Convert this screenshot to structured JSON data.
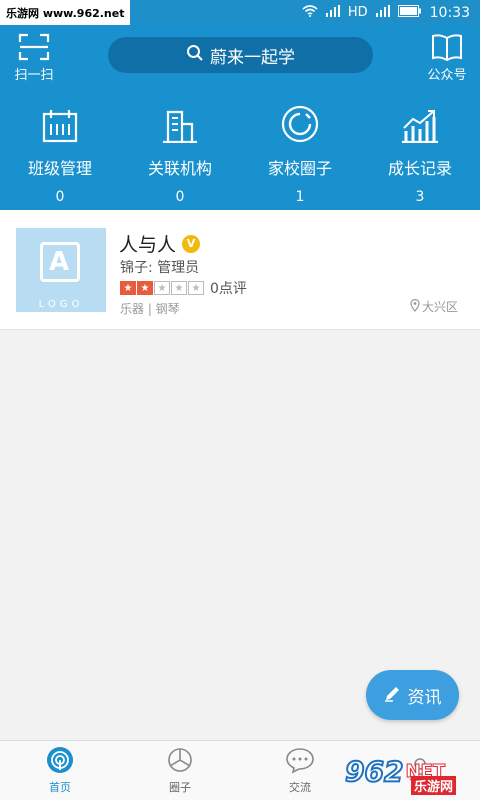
{
  "watermark_top": "乐游网 www.962.net",
  "status": {
    "network": "HD",
    "time": "10:33"
  },
  "header": {
    "scan_label": "扫一扫",
    "search_text": "蔚来一起学",
    "public_label": "公众号",
    "accent_color": "#1a91cf"
  },
  "features": [
    {
      "icon": "calendar-icon",
      "name": "班级管理",
      "count": "0"
    },
    {
      "icon": "building-icon",
      "name": "关联机构",
      "count": "0"
    },
    {
      "icon": "circle-icon",
      "name": "家校圈子",
      "count": "1"
    },
    {
      "icon": "growth-chart-icon",
      "name": "成长记录",
      "count": "3"
    }
  ],
  "org": {
    "logo_letter": "A",
    "logo_text": "LOGO",
    "name": "人与人",
    "verified_badge": "V",
    "admin": "锦子: 管理员",
    "rating": 2,
    "max_rating": 5,
    "reviews": "0点评",
    "tags": "乐器 | 钢琴",
    "district": "大兴区"
  },
  "fab": {
    "label": "资讯"
  },
  "tabs": [
    {
      "icon": "home-icon",
      "label": "首页",
      "active": true
    },
    {
      "icon": "circle-group-icon",
      "label": "圈子",
      "active": false
    },
    {
      "icon": "chat-icon",
      "label": "交流",
      "active": false
    },
    {
      "icon": "profile-icon",
      "label": "",
      "active": false
    }
  ],
  "watermark_bottom": {
    "number": "962",
    "net": "NET",
    "sub": "乐游网"
  }
}
